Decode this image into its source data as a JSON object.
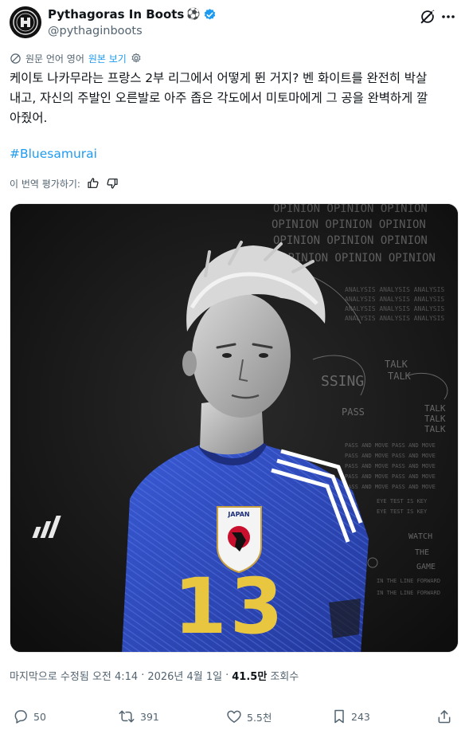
{
  "tweet": {
    "author": {
      "display_name": "Pythagoras In Boots",
      "name_emoji": "⚽",
      "handle": "@pythaginboots",
      "verified": true,
      "avatar_icon": "club-crest-icon"
    },
    "translation_bar": {
      "source_language_label": "원문 언어 영어",
      "show_original_label": "원본 보기",
      "icon": "translate-icon",
      "settings_icon": "gear-icon"
    },
    "text": "케이토 나카무라는 프랑스 2부 리그에서 어떻게 뛴 거지? 벤 화이트를 완전히 박살\n내고, 자신의 주발인 오른발로 아주 좁은 각도에서 미토마에게 그 공을 완벽하게 깔\n아줬어.",
    "hashtag": "#Bluesamurai",
    "rate_translation_label": "이 번역 평가하기:",
    "media": {
      "alt": "",
      "jersey_badge_text": "JAPAN",
      "jersey_number": "13",
      "background_words": [
        "OPINION",
        "ANALYSIS",
        "TALK",
        "PASS",
        "SING",
        "WATCH",
        "THE",
        "GAME"
      ]
    },
    "meta": {
      "edited_time": "마지막으로 수정됨 오전 4:14",
      "separator": "·",
      "date": "2026년 4월 1일",
      "separator2": "·",
      "views_count": "41.5만",
      "views_label": "조회수"
    },
    "actions": {
      "replies": "50",
      "reposts": "391",
      "likes": "5.5천",
      "bookmarks": "243"
    }
  },
  "colors": {
    "accent": "#1d9bf0",
    "text_primary": "#0f1419",
    "text_secondary": "#536471",
    "jersey_blue": "#2f4fc4",
    "number_yellow": "#e8c640"
  }
}
